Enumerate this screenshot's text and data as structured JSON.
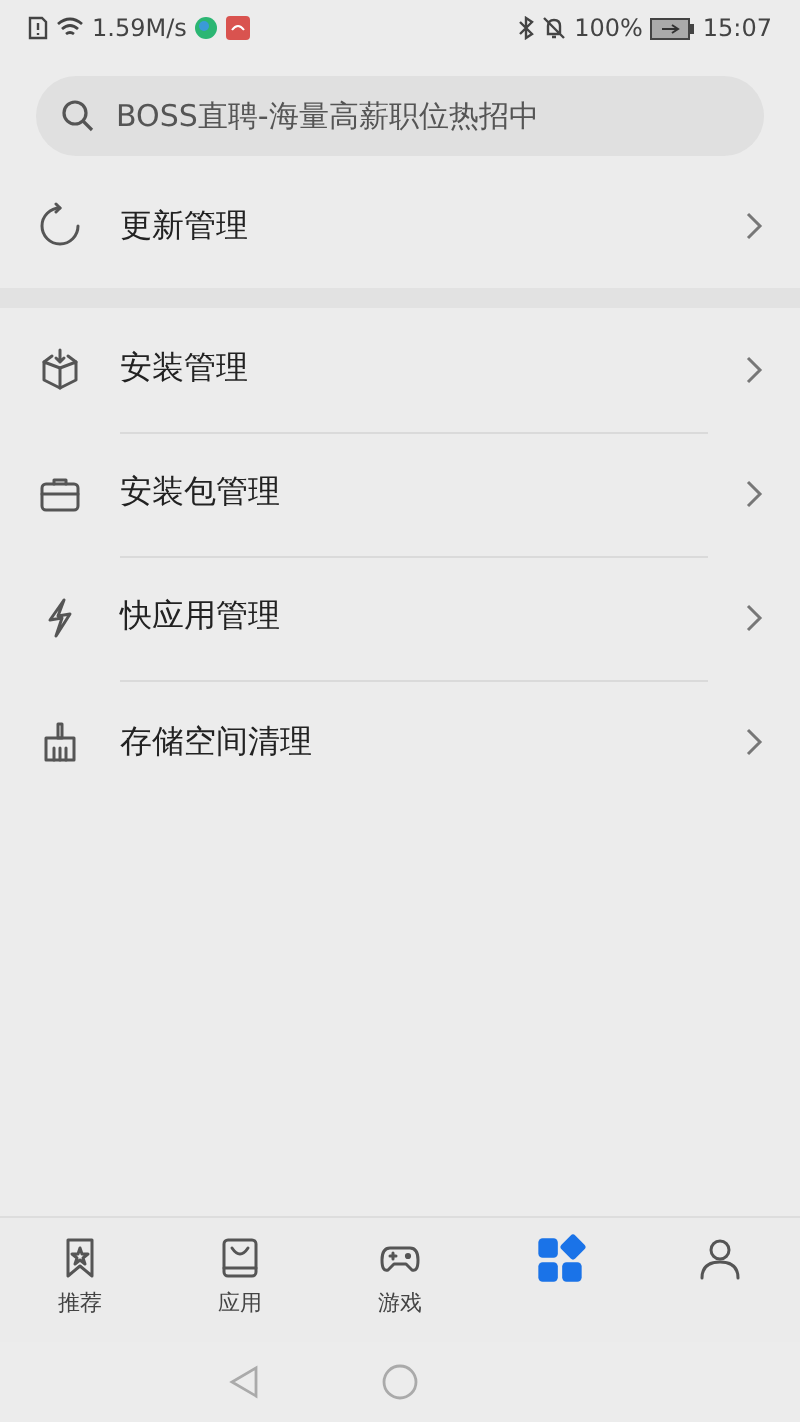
{
  "status_bar": {
    "speed": "1.59M/s",
    "battery": "100%",
    "time": "15:07"
  },
  "search": {
    "placeholder": "BOSS直聘-海量高薪职位热招中"
  },
  "sections": [
    {
      "items": [
        {
          "label": "更新管理"
        }
      ]
    },
    {
      "items": [
        {
          "label": "安装管理"
        },
        {
          "label": "安装包管理"
        },
        {
          "label": "快应用管理"
        },
        {
          "label": "存储空间清理"
        }
      ]
    }
  ],
  "tabs": [
    {
      "label": "推荐",
      "selected": false
    },
    {
      "label": "应用",
      "selected": false
    },
    {
      "label": "游戏",
      "selected": false
    },
    {
      "selected": true
    },
    {
      "selected": false
    }
  ]
}
